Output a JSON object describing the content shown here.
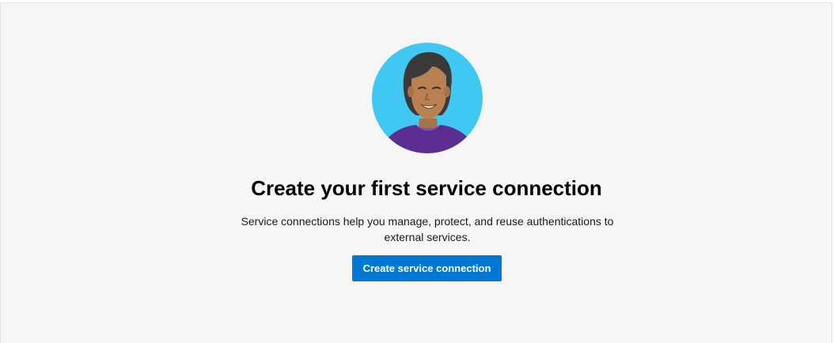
{
  "empty_state": {
    "illustration_icon": "person-avatar-illustration",
    "title": "Create your first service connection",
    "description": "Service connections help you manage, protect, and reuse authentications to external services.",
    "button_label": "Create service connection"
  },
  "colors": {
    "accent": "#0078d4",
    "background": "#f6f6f6",
    "avatar_bg": "#41c8f2",
    "shirt": "#5c2d91"
  }
}
